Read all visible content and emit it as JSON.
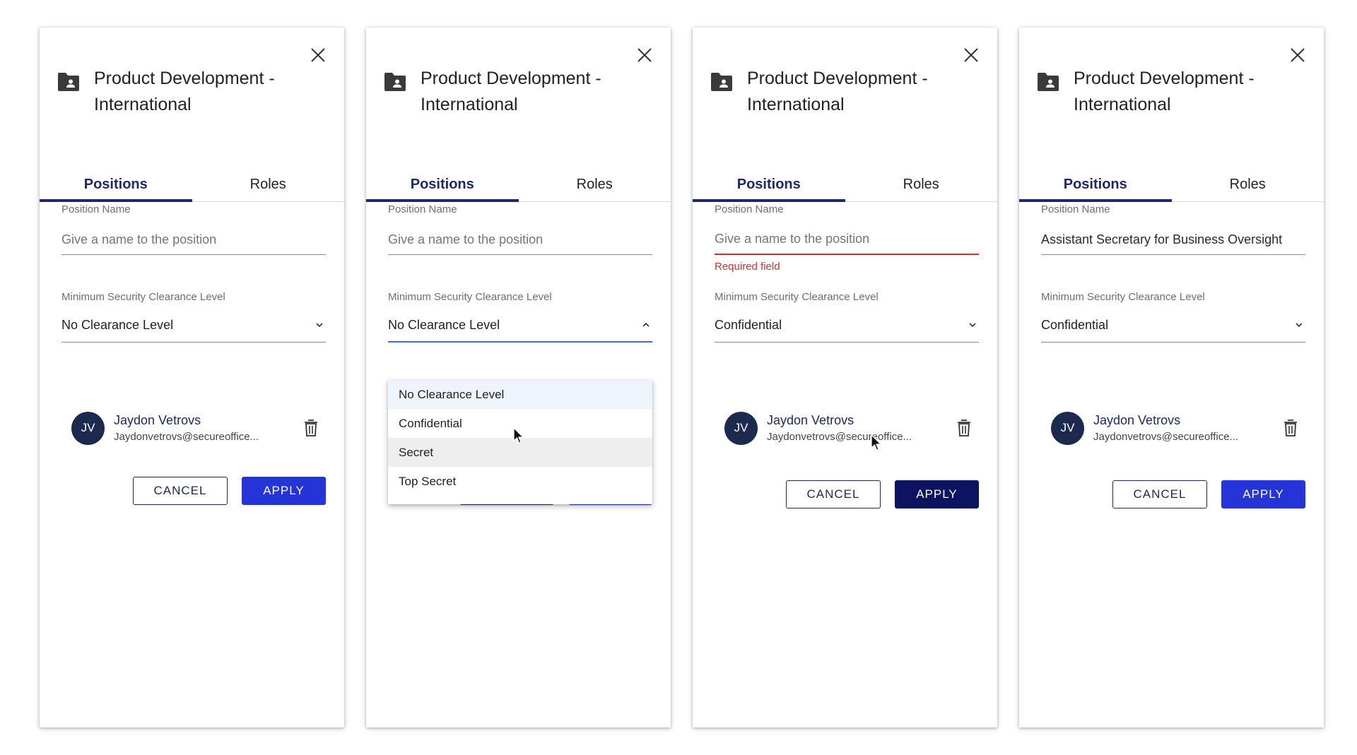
{
  "panels": [
    {
      "title": "Product Development - International",
      "tabs": [
        "Positions",
        "Roles"
      ],
      "active_tab": "Positions",
      "position_name": {
        "label": "Position Name",
        "value": "",
        "placeholder": "Give a name to the position"
      },
      "clearance": {
        "label": "Minimum Security Clearance Level",
        "value": "No Clearance Level"
      },
      "user": {
        "initials": "JV",
        "name": "Jaydon Vetrovs",
        "email": "Jaydonvetrovs@secureoffice..."
      },
      "cancel_label": "CANCEL",
      "apply_label": "APPLY"
    },
    {
      "title": "Product Development - International",
      "tabs": [
        "Positions",
        "Roles"
      ],
      "active_tab": "Positions",
      "position_name": {
        "label": "Position Name",
        "value": "",
        "placeholder": "Give a name to the position"
      },
      "clearance": {
        "label": "Minimum Security Clearance Level",
        "value": "No Clearance Level"
      },
      "dropdown_options": [
        "No Clearance Level",
        "Confidential",
        "Secret",
        "Top Secret"
      ],
      "dropdown_selected": "No Clearance Level",
      "dropdown_hover": "Secret"
    },
    {
      "title": "Product Development - International",
      "tabs": [
        "Positions",
        "Roles"
      ],
      "active_tab": "Positions",
      "position_name": {
        "label": "Position Name",
        "value": "",
        "placeholder": "Give a name to the position",
        "error": "Required field"
      },
      "clearance": {
        "label": "Minimum Security Clearance Level",
        "value": "Confidential"
      },
      "user": {
        "initials": "JV",
        "name": "Jaydon Vetrovs",
        "email": "Jaydonvetrovs@secureoffice..."
      },
      "cancel_label": "CANCEL",
      "apply_label": "APPLY"
    },
    {
      "title": "Product Development - International",
      "tabs": [
        "Positions",
        "Roles"
      ],
      "active_tab": "Positions",
      "position_name": {
        "label": "Position Name",
        "value": "Assistant Secretary for Business Oversight",
        "placeholder": "Give a name to the position"
      },
      "clearance": {
        "label": "Minimum Security Clearance Level",
        "value": "Confidential"
      },
      "user": {
        "initials": "JV",
        "name": "Jaydon Vetrovs",
        "email": "Jaydonvetrovs@secureoffice..."
      },
      "cancel_label": "CANCEL",
      "apply_label": "APPLY"
    }
  ],
  "colors": {
    "accent_navy": "#1a2a6c",
    "apply_blue": "#2434d9",
    "apply_dark": "#0c1462",
    "error_red": "#d32f2f",
    "focus_blue": "#3a6fe0",
    "avatar_bg": "#1c2a50"
  },
  "icons": [
    "close-icon",
    "folder-user-icon",
    "chevron-down-icon",
    "chevron-up-icon",
    "trash-icon",
    "cursor-arrow-icon"
  ]
}
